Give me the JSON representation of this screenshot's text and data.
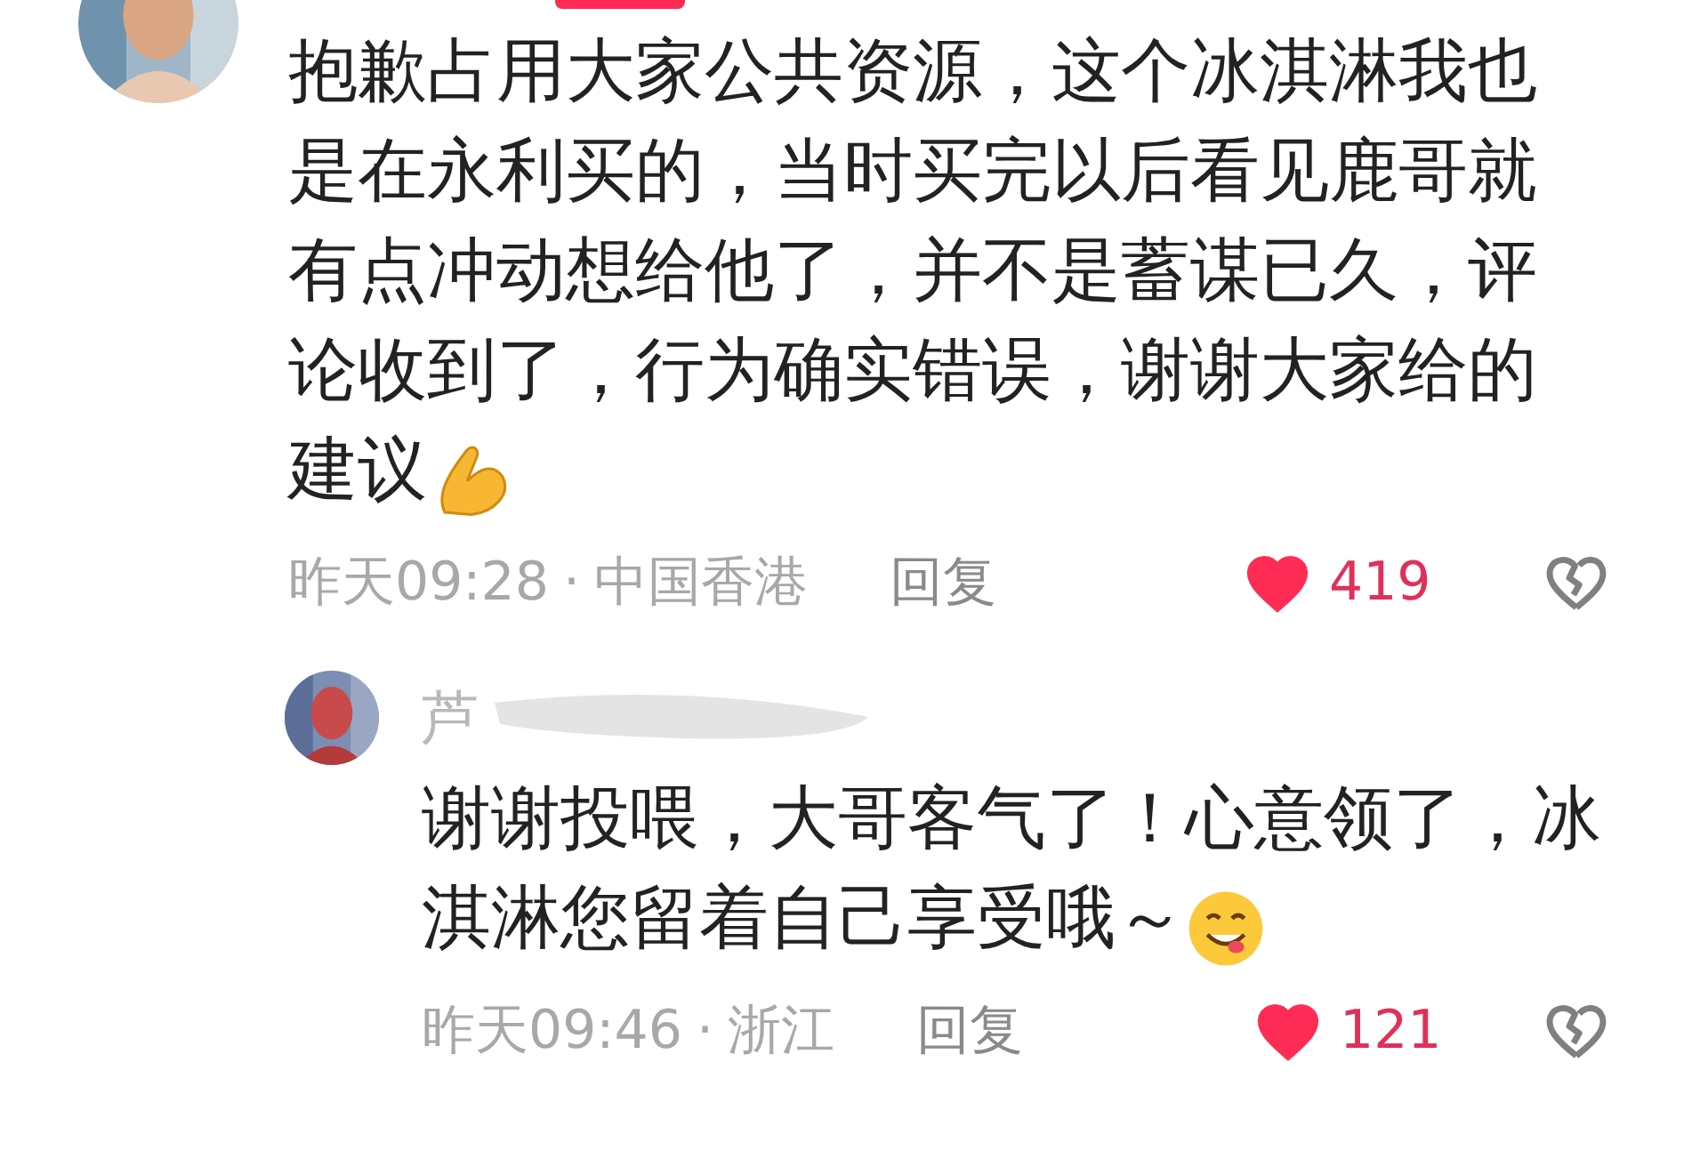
{
  "comment": {
    "text": "抱歉占用大家公共资源，这个冰淇淋我也是在永利买的，当时买完以后看见鹿哥就有点冲动想给他了，并不是蓄谋已久，评论收到了，行为确实错误，谢谢大家给的建议",
    "emoji": {
      "kind": "folded-hands"
    },
    "time": "昨天09:28",
    "separator": "·",
    "location": "中国香港",
    "reply_label": "回复",
    "liked": true,
    "likes": "419"
  },
  "reply": {
    "username": "芦",
    "text": "谢谢投喂，大哥客气了！心意领了，冰淇淋您留着自己享受哦～",
    "emoji": {
      "kind": "yum-face"
    },
    "time": "昨天09:46",
    "separator": "·",
    "location": "浙江",
    "reply_label": "回复",
    "liked": true,
    "likes": "121"
  }
}
